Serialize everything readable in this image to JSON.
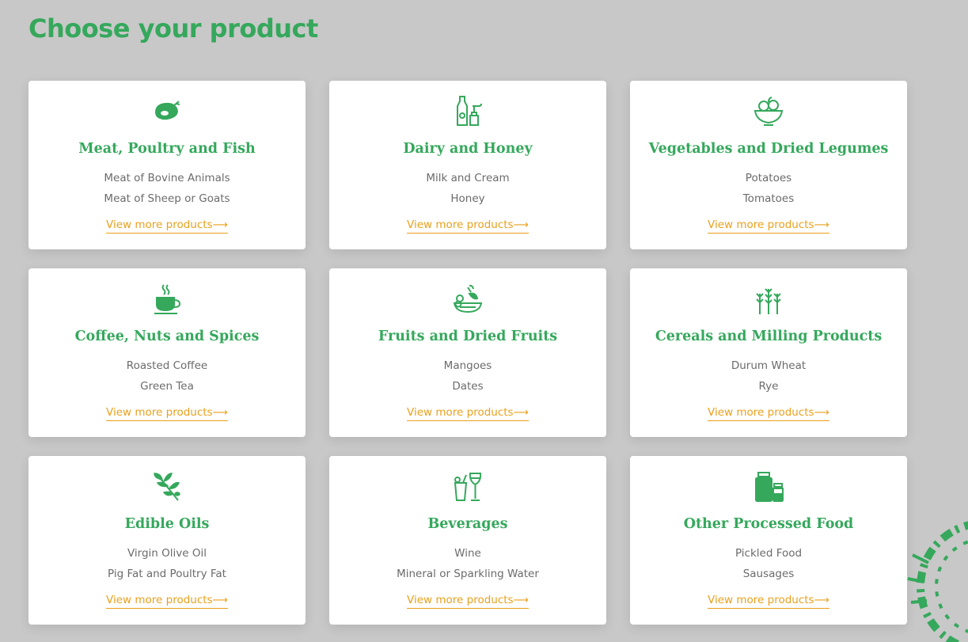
{
  "page_title": "Choose your product",
  "accent_green": "#35a85c",
  "link_orange": "#eaa01c",
  "more_label": "View more products⟶",
  "categories": [
    {
      "title": "Meat, Poultry and Fish",
      "icon": "meat-icon",
      "items": [
        "Meat of Bovine Animals",
        "Meat of Sheep or Goats"
      ]
    },
    {
      "title": "Dairy and Honey",
      "icon": "dairy-honey-icon",
      "items": [
        "Milk and Cream",
        "Honey"
      ]
    },
    {
      "title": "Vegetables and Dried Legumes",
      "icon": "salad-bowl-icon",
      "items": [
        "Potatoes",
        "Tomatoes"
      ]
    },
    {
      "title": "Coffee, Nuts and Spices",
      "icon": "coffee-cup-icon",
      "items": [
        "Roasted Coffee",
        "Green Tea"
      ]
    },
    {
      "title": "Fruits and Dried Fruits",
      "icon": "fruit-basket-icon",
      "items": [
        "Mangoes",
        "Dates"
      ]
    },
    {
      "title": "Cereals and Milling Products",
      "icon": "wheat-icon",
      "items": [
        "Durum Wheat",
        "Rye"
      ]
    },
    {
      "title": "Edible Oils",
      "icon": "olive-branch-icon",
      "items": [
        "Virgin Olive Oil",
        "Pig Fat and Poultry Fat"
      ]
    },
    {
      "title": "Beverages",
      "icon": "drinks-icon",
      "items": [
        "Wine",
        "Mineral or Sparkling Water"
      ]
    },
    {
      "title": "Other Processed Food",
      "icon": "jars-icon",
      "items": [
        "Pickled Food",
        "Sausages"
      ]
    }
  ]
}
